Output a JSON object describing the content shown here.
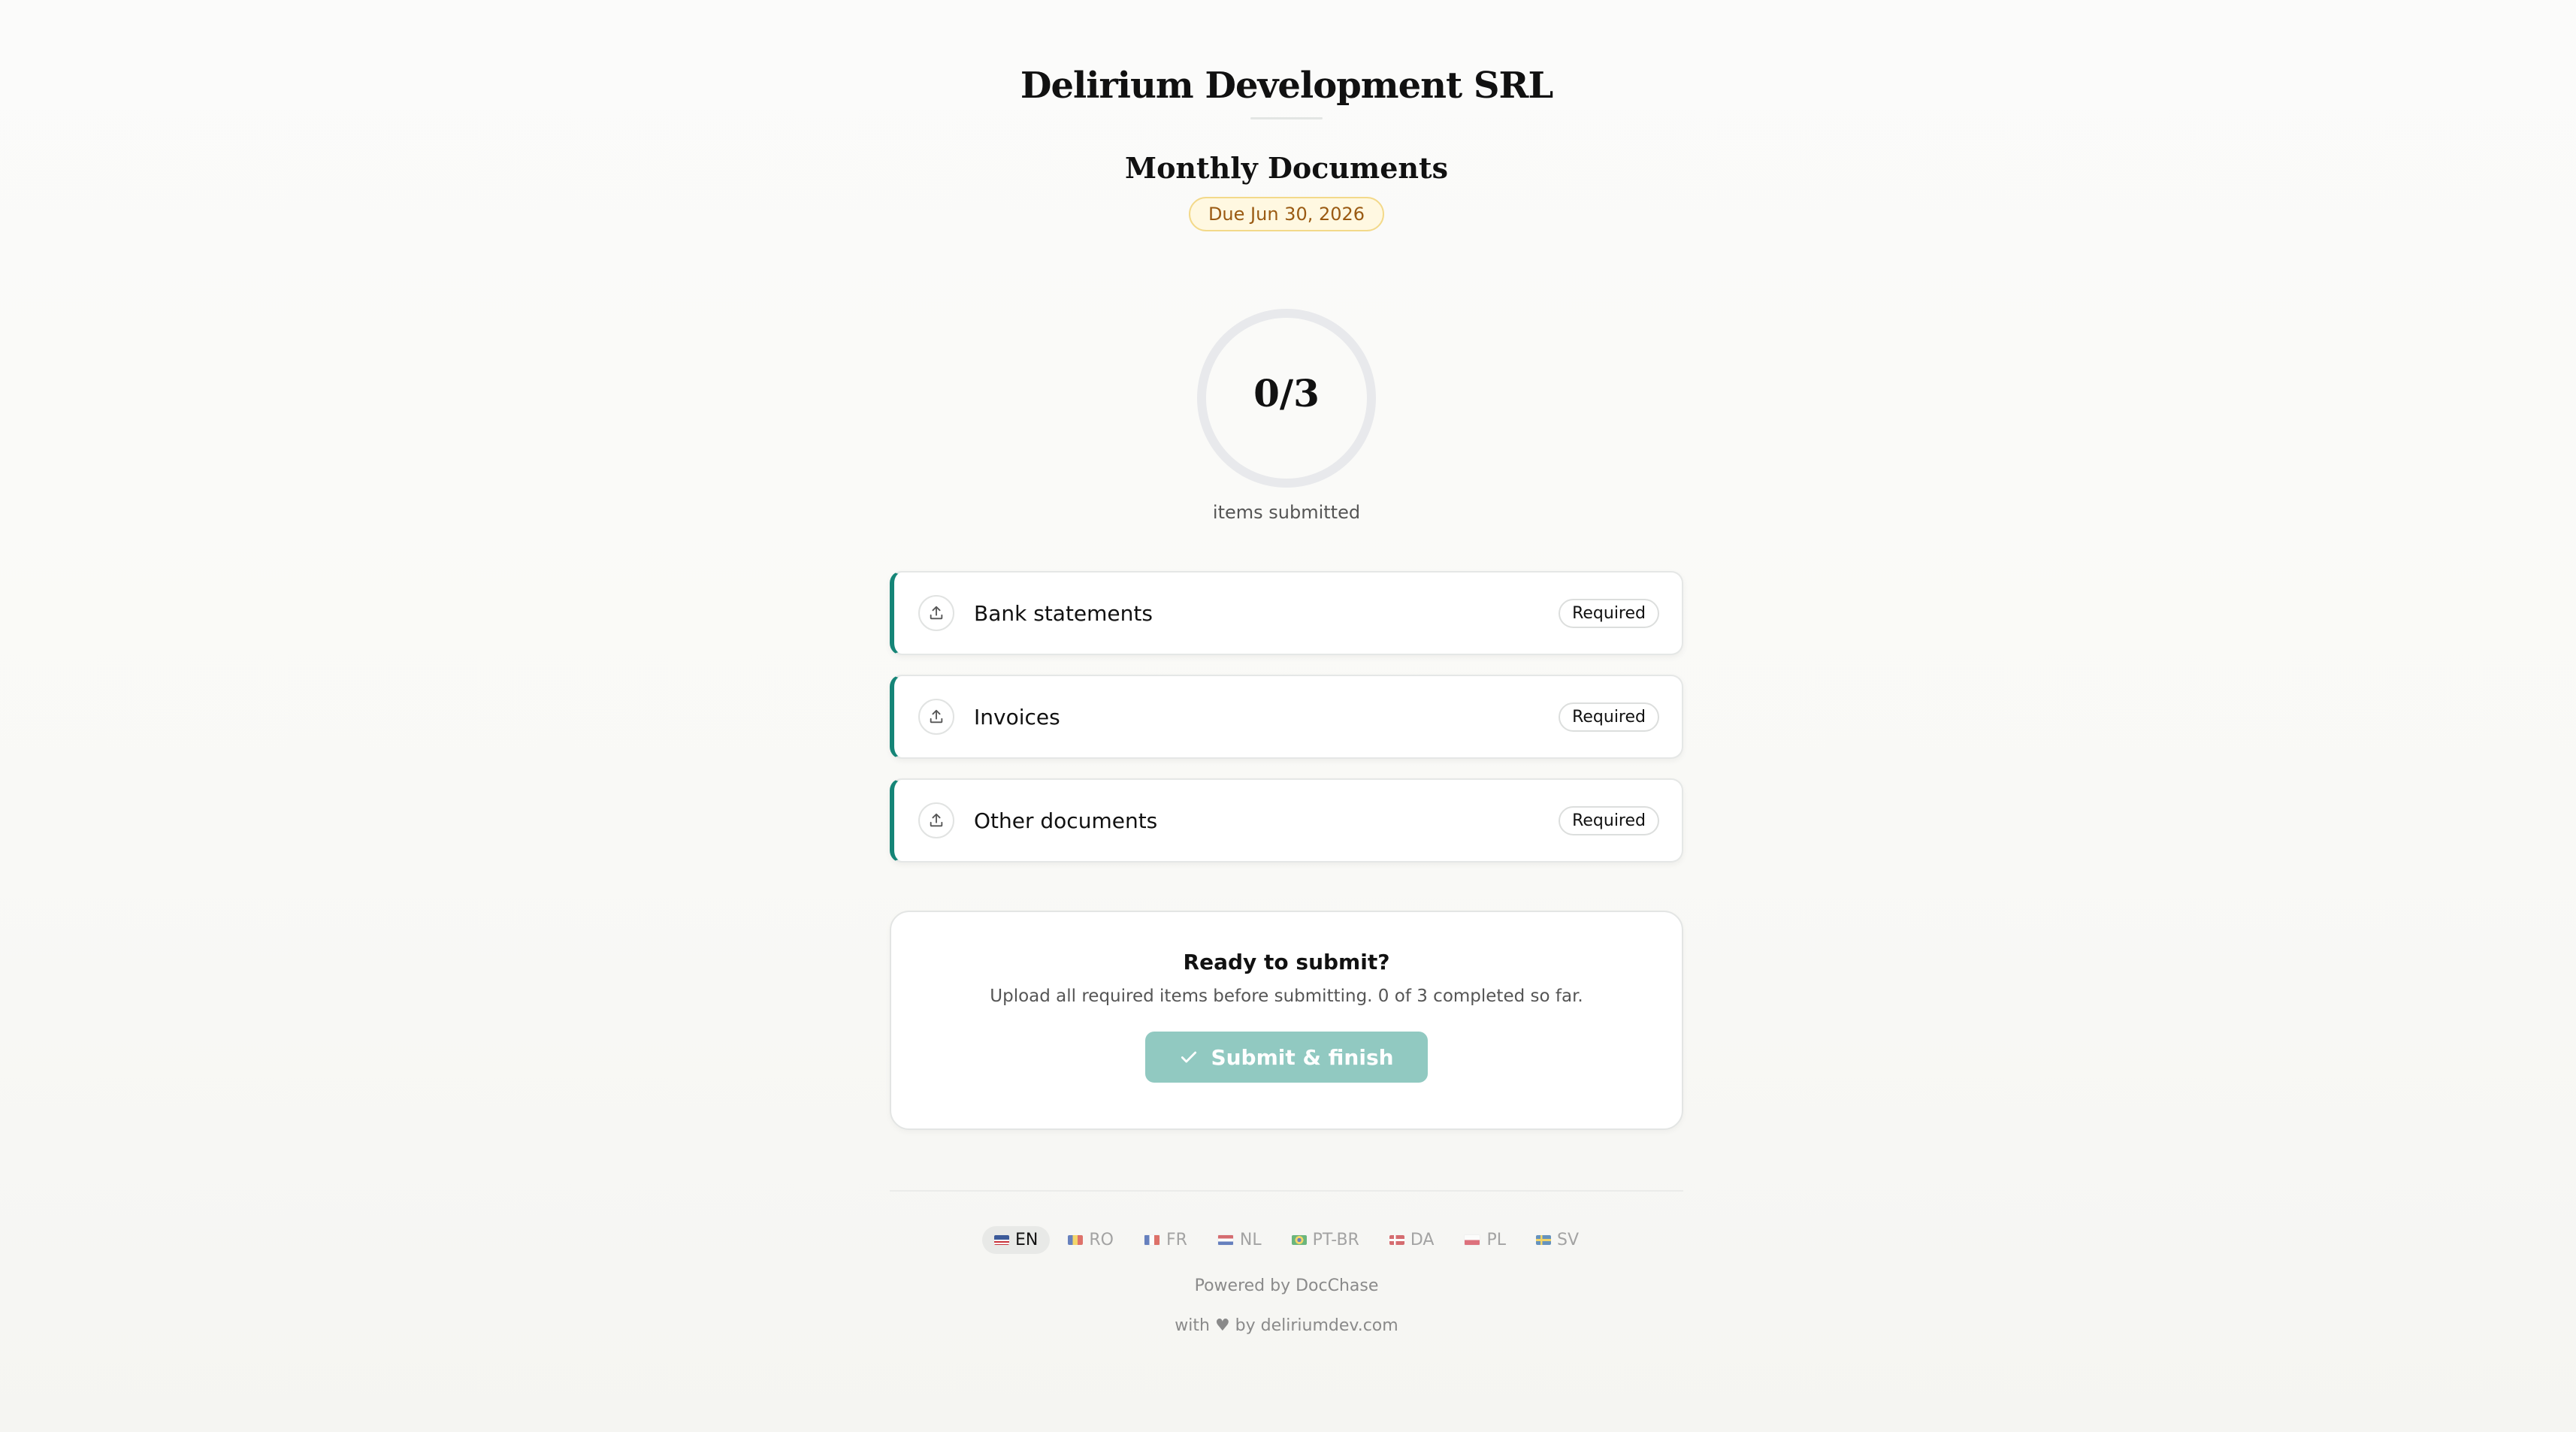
{
  "header": {
    "company": "Delirium Development SRL",
    "title": "Monthly Documents",
    "due": "Due Jun 30, 2026"
  },
  "progress": {
    "count_text": "0/3",
    "caption": "items submitted",
    "submitted": 0,
    "total": 3
  },
  "items": [
    {
      "label": "Bank statements",
      "badge": "Required",
      "icon": "upload-icon"
    },
    {
      "label": "Invoices",
      "badge": "Required",
      "icon": "upload-icon"
    },
    {
      "label": "Other documents",
      "badge": "Required",
      "icon": "upload-icon"
    }
  ],
  "submit": {
    "heading": "Ready to submit?",
    "description": "Upload all required items before submitting. 0 of 3 completed so far.",
    "button_label": "Submit & finish",
    "button_icon": "check-icon"
  },
  "languages": [
    {
      "code": "EN",
      "active": true
    },
    {
      "code": "RO",
      "active": false
    },
    {
      "code": "FR",
      "active": false
    },
    {
      "code": "NL",
      "active": false
    },
    {
      "code": "PT-BR",
      "active": false
    },
    {
      "code": "DA",
      "active": false
    },
    {
      "code": "PL",
      "active": false
    },
    {
      "code": "SV",
      "active": false
    }
  ],
  "footer": {
    "powered_by": "Powered by DocChase",
    "credit": "with ♥ by deliriumdev.com"
  },
  "colors": {
    "accent": "#158577",
    "submit_button_disabled": "#91c9c1",
    "due_badge_bg": "#fff8e1",
    "due_badge_border": "#f3d98a",
    "due_badge_text": "#9a5a12",
    "ring_track": "#e8e9ec"
  }
}
